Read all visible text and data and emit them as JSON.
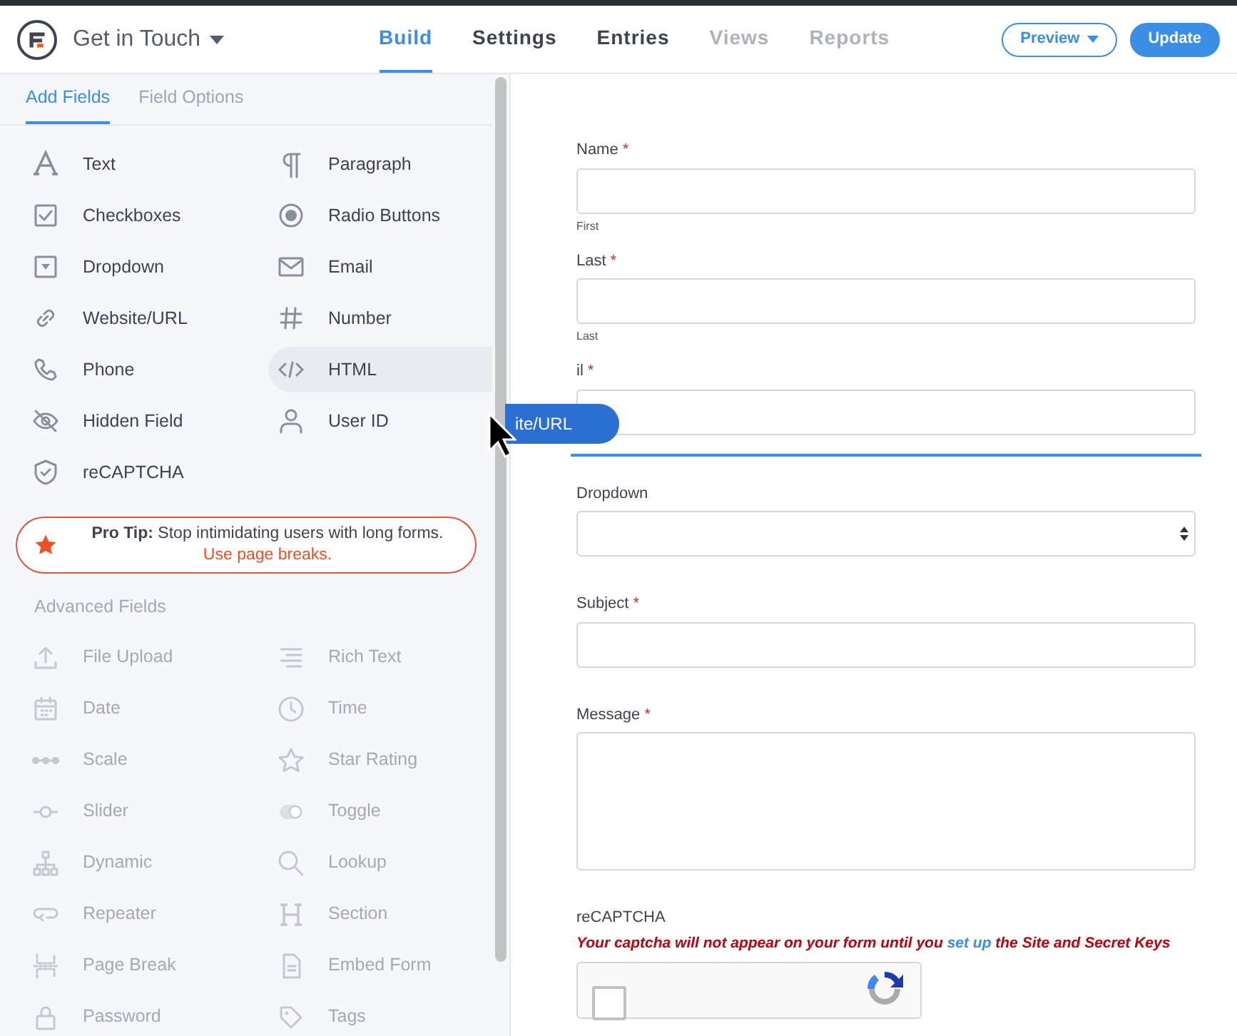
{
  "header": {
    "form_title": "Get in Touch",
    "tabs": [
      {
        "label": "Build",
        "selected": true,
        "disabled": false
      },
      {
        "label": "Settings",
        "selected": false,
        "disabled": false
      },
      {
        "label": "Entries",
        "selected": false,
        "disabled": false
      },
      {
        "label": "Views",
        "selected": false,
        "disabled": true
      },
      {
        "label": "Reports",
        "selected": false,
        "disabled": true
      }
    ],
    "buttons": [
      {
        "label": "Preview",
        "kind": "outline"
      },
      {
        "label": "Update",
        "kind": "solid"
      }
    ]
  },
  "sidebar": {
    "tabs": [
      {
        "label": "Add Fields",
        "selected": true
      },
      {
        "label": "Field Options",
        "selected": false
      }
    ],
    "fields": [
      {
        "label": "Text",
        "highlighted": false
      },
      {
        "label": "Paragraph",
        "highlighted": false
      },
      {
        "label": "Checkboxes",
        "highlighted": false
      },
      {
        "label": "Radio Buttons",
        "highlighted": false
      },
      {
        "label": "Dropdown",
        "highlighted": false
      },
      {
        "label": "Email",
        "highlighted": false
      },
      {
        "label": "Website/URL",
        "highlighted": false
      },
      {
        "label": "Number",
        "highlighted": false
      },
      {
        "label": "Phone",
        "highlighted": false
      },
      {
        "label": "HTML",
        "highlighted": true
      },
      {
        "label": "Hidden Field",
        "highlighted": false
      },
      {
        "label": "User ID",
        "highlighted": false
      },
      {
        "label": "reCAPTCHA",
        "highlighted": false
      }
    ],
    "pro_tip": {
      "text": "**Pro Tip:** Stop intimidating users with long forms.",
      "link": "Use page breaks."
    },
    "advanced_heading": "Advanced Fields",
    "advanced_fields": [
      {
        "label": "File Upload"
      },
      {
        "label": "Rich Text"
      },
      {
        "label": "Date"
      },
      {
        "label": "Time"
      },
      {
        "label": "Scale"
      },
      {
        "label": "Star Rating"
      },
      {
        "label": "Slider"
      },
      {
        "label": "Toggle"
      },
      {
        "label": "Dynamic"
      },
      {
        "label": "Lookup"
      },
      {
        "label": "Repeater"
      },
      {
        "label": "Section"
      },
      {
        "label": "Page Break"
      },
      {
        "label": "Embed Form"
      },
      {
        "label": "Password"
      },
      {
        "label": "Tags"
      }
    ]
  },
  "drag_chip": {
    "label": "ite/URL"
  },
  "form": {
    "fields": [
      {
        "label": "Name",
        "required_mark": "*",
        "kind": "text",
        "sublabel": "First"
      },
      {
        "label": "Last",
        "required_mark": "*",
        "kind": "text",
        "sublabel": "Last"
      },
      {
        "label": "il",
        "required_mark": "*",
        "kind": "text",
        "drop_target": true
      },
      {
        "label": "Dropdown",
        "kind": "select"
      },
      {
        "label": "Subject",
        "required_mark": "*",
        "kind": "text"
      },
      {
        "label": "Message",
        "required_mark": "*",
        "kind": "textarea"
      },
      {
        "label": "reCAPTCHA",
        "kind": "captcha",
        "checked": false,
        "warning": "Your captcha will not appear on your form until you",
        "warning_link": "set up",
        "warning_end": "the Site and Secret Keys"
      }
    ]
  }
}
